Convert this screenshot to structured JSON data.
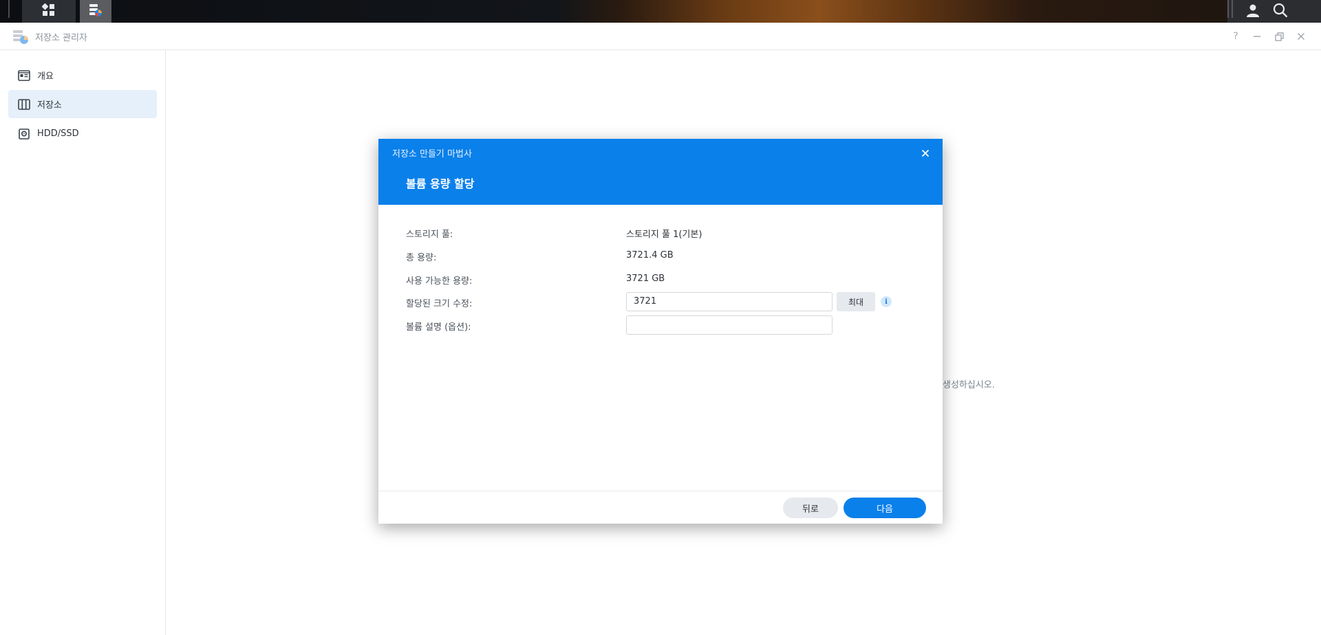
{
  "colors": {
    "accent": "#0a80ea",
    "active_nav_bg": "#e5f0fb",
    "taskbar_bg": "#121519"
  },
  "taskbar": {
    "icons": [
      "main-menu-icon",
      "storage-manager-icon",
      "user-icon",
      "search-icon"
    ]
  },
  "window": {
    "title": "저장소 관리자",
    "controls": [
      "help-icon",
      "minimize-icon",
      "restore-icon",
      "close-icon"
    ]
  },
  "sidebar": {
    "items": [
      {
        "label": "개요",
        "icon": "overview-icon",
        "active": false
      },
      {
        "label": "저장소",
        "icon": "storage-icon",
        "active": true
      },
      {
        "label": "HDD/SSD",
        "icon": "disk-icon",
        "active": false
      }
    ]
  },
  "background": {
    "hint_fragment": "생성하십시오."
  },
  "dialog": {
    "wizard_title": "저장소 만들기 마법사",
    "step_title": "볼륨 용량 할당",
    "rows": {
      "pool": {
        "label": "스토리지 풀:",
        "value": "스토리지 풀 1(기본)"
      },
      "total": {
        "label": "총 용량:",
        "value": "3721.4 GB"
      },
      "available": {
        "label": "사용 가능한 용량:",
        "value": "3721 GB"
      },
      "allocated": {
        "label": "할당된 크기 수정:",
        "value": "3721",
        "max_label": "최대"
      },
      "description": {
        "label": "볼륨 설명 (옵션):",
        "value": ""
      }
    },
    "footer": {
      "back_label": "뒤로",
      "next_label": "다음"
    }
  }
}
